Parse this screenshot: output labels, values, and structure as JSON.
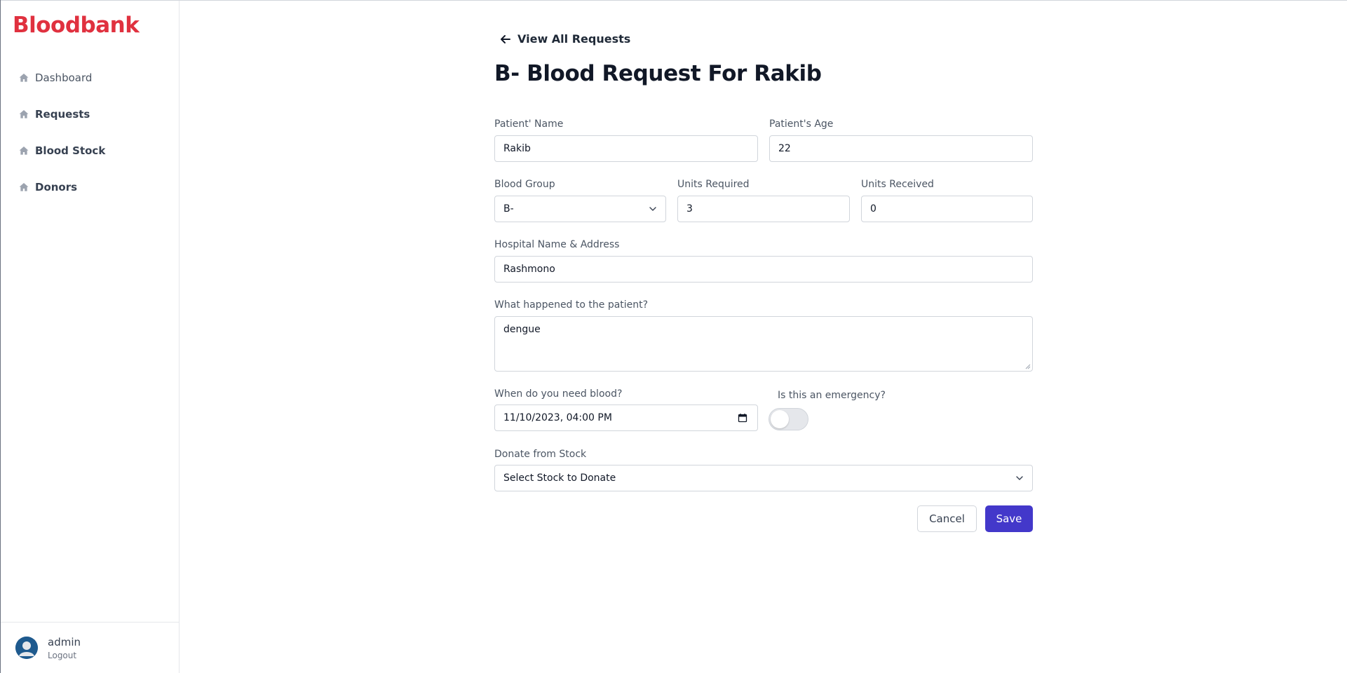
{
  "app": {
    "brand": "Bloodbank"
  },
  "sidebar": {
    "items": [
      {
        "label": "Dashboard",
        "icon": "home-icon"
      },
      {
        "label": "Requests",
        "icon": "home-icon"
      },
      {
        "label": "Blood Stock",
        "icon": "home-icon"
      },
      {
        "label": "Donors",
        "icon": "home-icon"
      }
    ]
  },
  "user": {
    "name": "admin",
    "logout_label": "Logout"
  },
  "header": {
    "back_label": "View All Requests",
    "title": "B- Blood Request For Rakib"
  },
  "form": {
    "patient_name": {
      "label": "Patient' Name",
      "value": "Rakib"
    },
    "patient_age": {
      "label": "Patient's Age",
      "value": "22"
    },
    "blood_group": {
      "label": "Blood Group",
      "value": "B-"
    },
    "units_required": {
      "label": "Units Required",
      "value": "3"
    },
    "units_received": {
      "label": "Units Received",
      "value": "0"
    },
    "hospital": {
      "label": "Hospital Name & Address",
      "value": "Rashmono"
    },
    "condition": {
      "label": "What happened to the patient?",
      "value": "dengue"
    },
    "needed_at": {
      "label": "When do you need blood?",
      "value": "11/10/2023, 04:00 PM"
    },
    "emergency": {
      "label": "Is this an emergency?",
      "checked": false
    },
    "donate_from_stock": {
      "label": "Donate from Stock",
      "value": "Select Stock to Donate"
    }
  },
  "actions": {
    "cancel_label": "Cancel",
    "save_label": "Save"
  },
  "colors": {
    "brand": "#e0313f",
    "primary": "#4338ca"
  }
}
